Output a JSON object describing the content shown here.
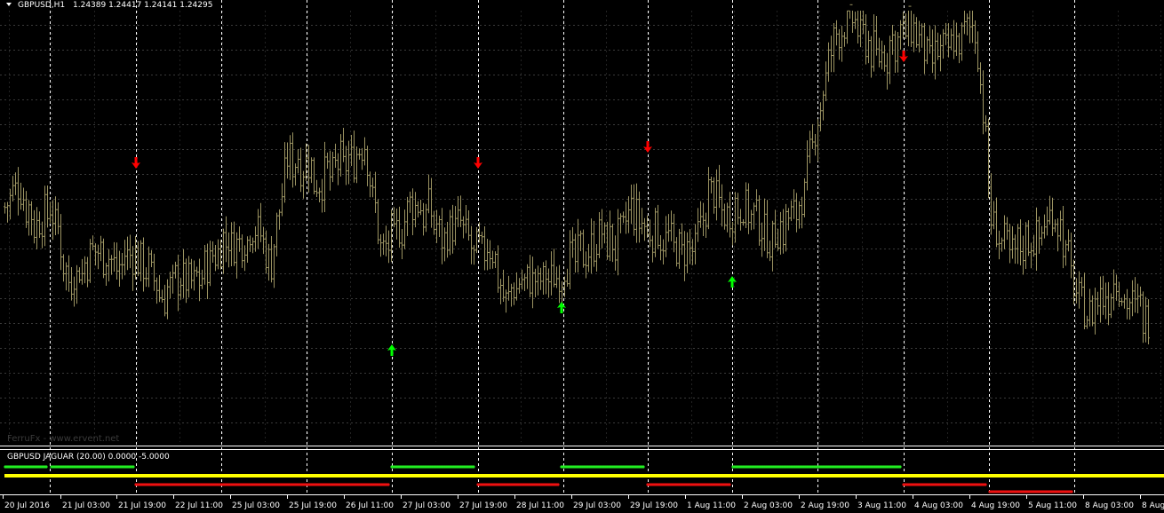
{
  "header": {
    "symbol_label": "GBPUSD,H1",
    "ohlc": "1.24389 1.24417 1.24141 1.24295"
  },
  "watermark": "FerruFx - www.ervent.net",
  "indicator": {
    "label": "GBPUSD  JAGUAR (20.00) 0.0000 -5.0000"
  },
  "colors": {
    "background": "#000000",
    "candle": "#9c9462",
    "grid_dotted": "#3a3a3a",
    "separator": "#ffffff",
    "up_arrow": "#00ff00",
    "down_arrow": "#ff0000",
    "indicator_green": "#22ee22",
    "indicator_red": "#ee1111",
    "indicator_yellow": "#ffff00"
  },
  "chart_data": {
    "type": "bar",
    "x_ticks": [
      "20 Jul 2016",
      "21 Jul 03:00",
      "21 Jul 19:00",
      "22 Jul 11:00",
      "25 Jul 03:00",
      "25 Jul 19:00",
      "26 Jul 11:00",
      "27 Jul 03:00",
      "27 Jul 19:00",
      "28 Jul 11:00",
      "29 Jul 03:00",
      "29 Jul 19:00",
      "1 Aug 11:00",
      "2 Aug 03:00",
      "2 Aug 19:00",
      "3 Aug 11:00",
      "4 Aug 03:00",
      "4 Aug 19:00",
      "5 Aug 11:00",
      "8 Aug 03:00",
      "8 Aug"
    ],
    "grid": true,
    "price_path": [
      0.72,
      0.78,
      0.65,
      0.72,
      0.48,
      0.5,
      0.58,
      0.52,
      0.55,
      0.52,
      0.4,
      0.48,
      0.46,
      0.52,
      0.6,
      0.58,
      0.66,
      0.52,
      0.88,
      0.88,
      0.8,
      0.84,
      0.88,
      0.92,
      0.58,
      0.62,
      0.72,
      0.7,
      0.62,
      0.66,
      0.55,
      0.58,
      0.4,
      0.48,
      0.45,
      0.49,
      0.52,
      0.57,
      0.62,
      0.58,
      0.7,
      0.62,
      0.63,
      0.56,
      0.55,
      0.78,
      0.7,
      0.73,
      0.66,
      0.61,
      0.67,
      0.75,
      1.05,
      1.3,
      1.35,
      1.28,
      1.22,
      1.3,
      1.32,
      1.2,
      1.26,
      1.3,
      1.33,
      0.66,
      0.56,
      0.6,
      0.62,
      0.72,
      0.5,
      0.35,
      0.4,
      0.46,
      0.38,
      0.34
    ],
    "arrows": [
      {
        "type": "down",
        "x": 153
      },
      {
        "type": "up",
        "x": 441
      },
      {
        "type": "down",
        "x": 538
      },
      {
        "type": "up",
        "x": 632
      },
      {
        "type": "down",
        "x": 729
      },
      {
        "type": "up",
        "x": 824
      },
      {
        "type": "down",
        "x": 1017
      }
    ],
    "indicator_segments": [
      {
        "row": "green",
        "x1": 5,
        "x2": 52
      },
      {
        "row": "green",
        "x1": 57,
        "x2": 150
      },
      {
        "row": "red",
        "x1": 152,
        "x2": 437
      },
      {
        "row": "green",
        "x1": 440,
        "x2": 533
      },
      {
        "row": "red",
        "x1": 537,
        "x2": 628
      },
      {
        "row": "green",
        "x1": 631,
        "x2": 724
      },
      {
        "row": "red",
        "x1": 728,
        "x2": 821
      },
      {
        "row": "green",
        "x1": 824,
        "x2": 1013
      },
      {
        "row": "red",
        "x1": 1016,
        "x2": 1109
      },
      {
        "row": "red2",
        "x1": 1113,
        "x2": 1205
      }
    ]
  }
}
